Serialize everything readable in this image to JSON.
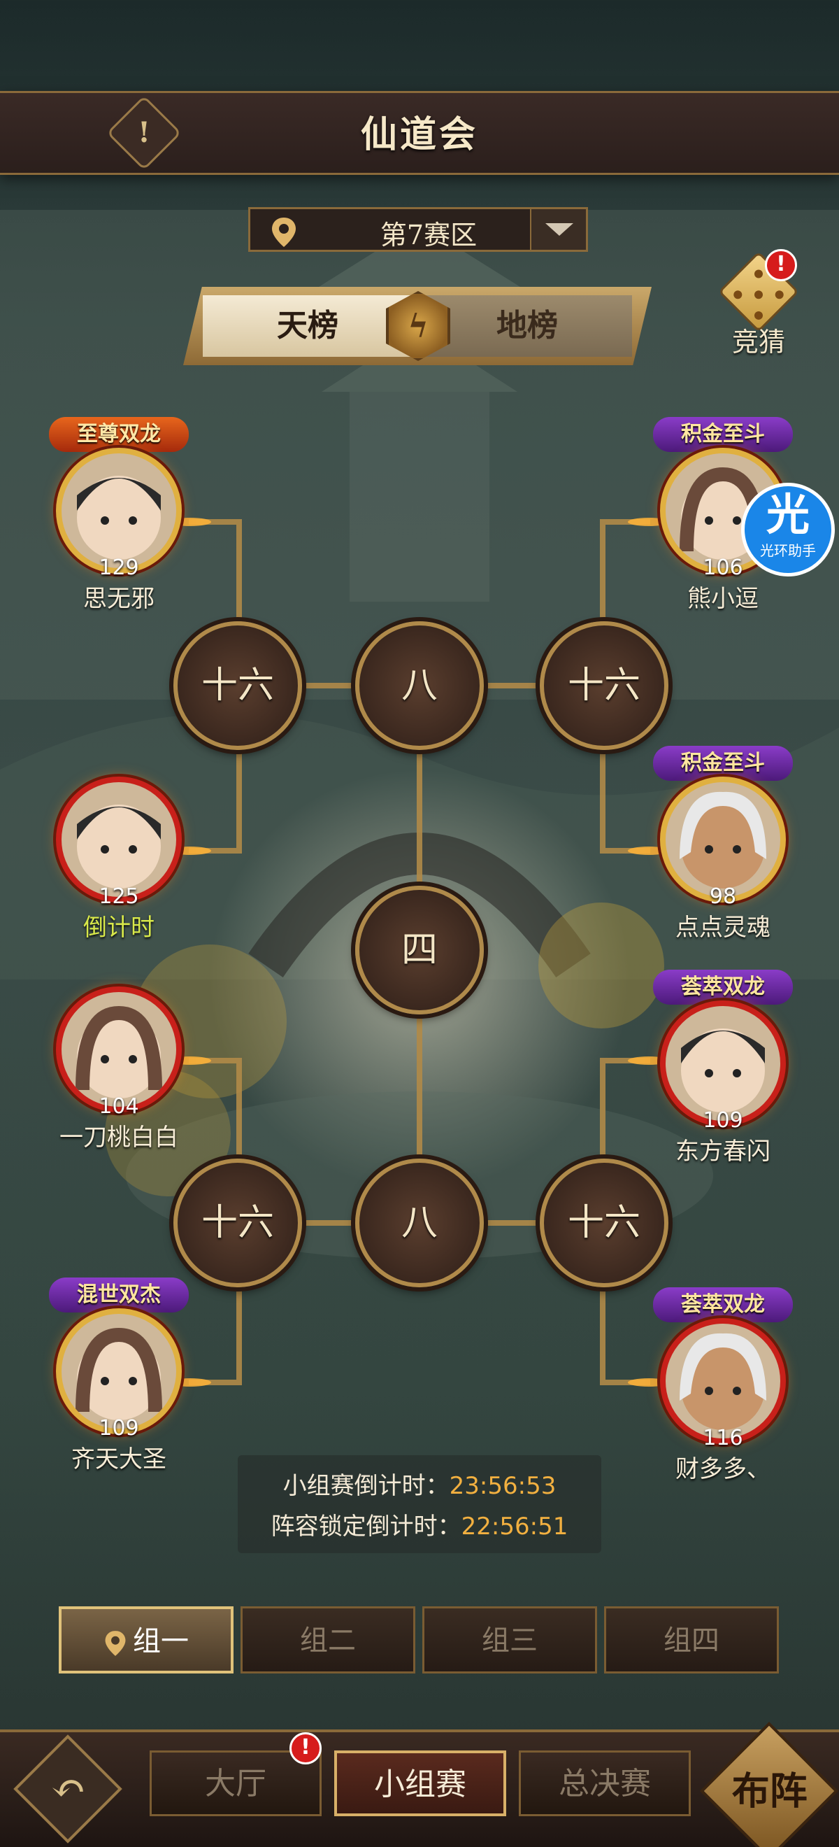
{
  "header": {
    "title": "仙道会",
    "info_icon": "!"
  },
  "region": {
    "label": "第7赛区"
  },
  "rank_tabs": {
    "active": "天榜",
    "inactive": "地榜"
  },
  "guess": {
    "label": "竞猜",
    "badge": "!"
  },
  "bracket": {
    "nodes": {
      "round16": "十六",
      "round8": "八",
      "round4": "四"
    }
  },
  "players": {
    "left": [
      {
        "tag": "至尊双龙",
        "level": "129",
        "name": "思无邪"
      },
      {
        "tag": "",
        "level": "125",
        "name": "倒计时"
      },
      {
        "tag": "",
        "level": "104",
        "name": "一刀桃白白"
      },
      {
        "tag": "混世双杰",
        "level": "109",
        "name": "齐天大圣"
      }
    ],
    "right": [
      {
        "tag": "积金至斗",
        "level": "106",
        "name": "熊小逗"
      },
      {
        "tag": "积金至斗",
        "level": "98",
        "name": "点点灵魂"
      },
      {
        "tag": "荟萃双龙",
        "level": "109",
        "name": "东方春闪"
      },
      {
        "tag": "荟萃双龙",
        "level": "116",
        "name": "财多多、"
      }
    ]
  },
  "countdown": {
    "group_label": "小组赛倒计时：",
    "group_value": "23:56:53",
    "lock_label": "阵容锁定倒计时：",
    "lock_value": "22:56:51"
  },
  "groups": [
    "组一",
    "组二",
    "组三",
    "组四"
  ],
  "bottom_nav": {
    "hall": "大厅",
    "hall_badge": "!",
    "group_stage": "小组赛",
    "finals": "总决赛",
    "formation": "布阵"
  },
  "overlay": {
    "icon_text": "光",
    "label": "光环助手"
  },
  "colors": {
    "accent_gold": "#b08a4a",
    "countdown_value": "#f2b040",
    "badge_red": "#d61c1c",
    "helper_blue": "#1a86e8"
  }
}
